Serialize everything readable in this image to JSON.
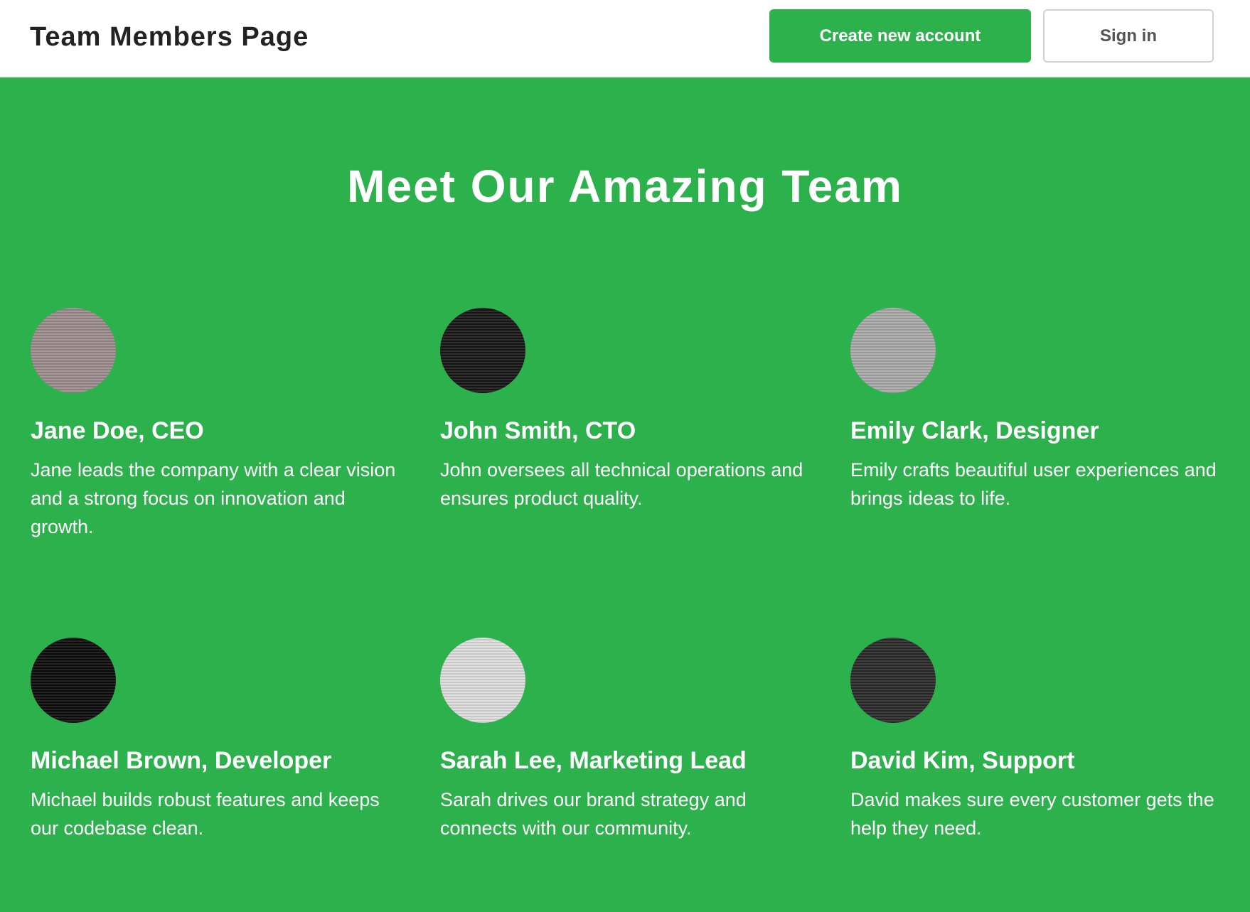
{
  "header": {
    "brand": "Team Members Page",
    "primary_button": "Create new account",
    "secondary_button": "Sign in"
  },
  "hero": {
    "title": "Meet Our Amazing Team"
  },
  "members": [
    {
      "name": "Jane Doe, CEO",
      "description": "Jane leads the company with a clear vision and a strong focus on innovation and growth.",
      "avatar_color": "#9c8c8c"
    },
    {
      "name": "John Smith, CTO",
      "description": "John oversees all technical operations and ensures product quality.",
      "avatar_color": "#161616"
    },
    {
      "name": "Emily Clark, Designer",
      "description": "Emily crafts beautiful user experiences and brings ideas to life.",
      "avatar_color": "#a9a9a9"
    },
    {
      "name": "Michael Brown, Developer",
      "description": "Michael builds robust features and keeps our codebase clean.",
      "avatar_color": "#0c0c0c"
    },
    {
      "name": "Sarah Lee, Marketing Lead",
      "description": "Sarah drives our brand strategy and connects with our community.",
      "avatar_color": "#dedede"
    },
    {
      "name": "David Kim, Support",
      "description": "David makes sure every customer gets the help they need.",
      "avatar_color": "#2a2a2a"
    }
  ]
}
